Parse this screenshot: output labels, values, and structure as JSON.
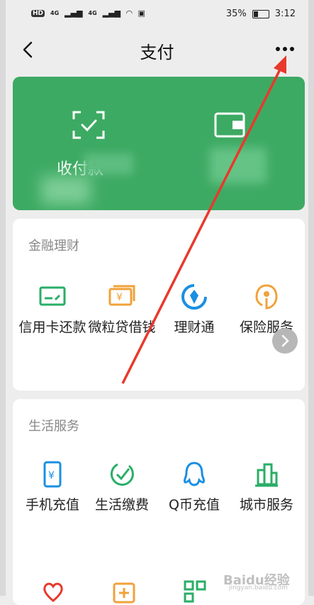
{
  "status_bar": {
    "network": "HD",
    "signal_1": "4G",
    "signal_2": "4G",
    "battery_percent": "35%",
    "time": "3:12"
  },
  "navbar": {
    "title": "支付",
    "back_icon": "chevron-left-icon",
    "more_icon": "more-dots-icon"
  },
  "payment_card": {
    "background_color": "#3daa63",
    "items": [
      {
        "label": "收付款",
        "icon": "qr-scan-icon"
      },
      {
        "label": "",
        "icon": "wallet-icon"
      }
    ]
  },
  "finance": {
    "title": "金融理财",
    "items": [
      {
        "label": "信用卡还款",
        "icon": "credit-card-icon",
        "color": "#2aae67"
      },
      {
        "label": "微粒贷借钱",
        "icon": "loan-icon",
        "color": "#f0a23b"
      },
      {
        "label": "理财通",
        "icon": "wealth-icon",
        "color": "#1a8fe3"
      },
      {
        "label": "保险服务",
        "icon": "insurance-icon",
        "color": "#f0a23b"
      }
    ]
  },
  "life": {
    "title": "生活服务",
    "items": [
      {
        "label": "手机充值",
        "icon": "phone-recharge-icon",
        "color": "#1a8fe3"
      },
      {
        "label": "生活缴费",
        "icon": "utility-bill-icon",
        "color": "#2aae67"
      },
      {
        "label": "Q币充值",
        "icon": "qq-coin-icon",
        "color": "#1a8fe3"
      },
      {
        "label": "城市服务",
        "icon": "city-service-icon",
        "color": "#2aae67"
      }
    ]
  },
  "watermark": {
    "text": "Baidu经验",
    "url": "jingyan.baidu.com"
  },
  "annotation_color": "#e8392c"
}
